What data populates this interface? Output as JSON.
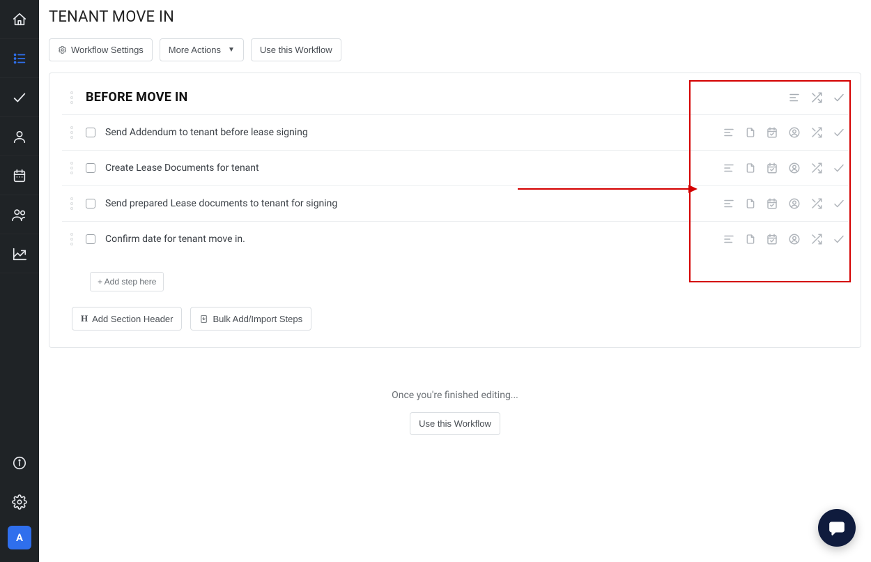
{
  "sidebar": {
    "items": [
      {
        "name": "home"
      },
      {
        "name": "list",
        "active": true
      },
      {
        "name": "check"
      },
      {
        "name": "user"
      },
      {
        "name": "calendar"
      },
      {
        "name": "users"
      },
      {
        "name": "chart"
      }
    ],
    "footer_items": [
      {
        "name": "info"
      },
      {
        "name": "gear"
      }
    ],
    "avatar_initial": "A"
  },
  "page": {
    "title": "TENANT MOVE IN"
  },
  "toolbar": {
    "workflow_settings_label": "Workflow Settings",
    "more_actions_label": "More Actions",
    "use_workflow_label": "Use this Workflow"
  },
  "workflow": {
    "section_title": "BEFORE MOVE IN",
    "steps": [
      {
        "label": "Send Addendum to tenant before lease signing"
      },
      {
        "label": "Create Lease Documents for tenant"
      },
      {
        "label": "Send prepared Lease documents to tenant for signing"
      },
      {
        "label": "Confirm date for tenant move in."
      }
    ],
    "add_step_label": "+ Add step here",
    "add_section_header_label": "Add Section Header",
    "bulk_add_label": "Bulk Add/Import Steps"
  },
  "footer": {
    "finished_text": "Once you're finished editing...",
    "use_workflow_label": "Use this Workflow"
  }
}
